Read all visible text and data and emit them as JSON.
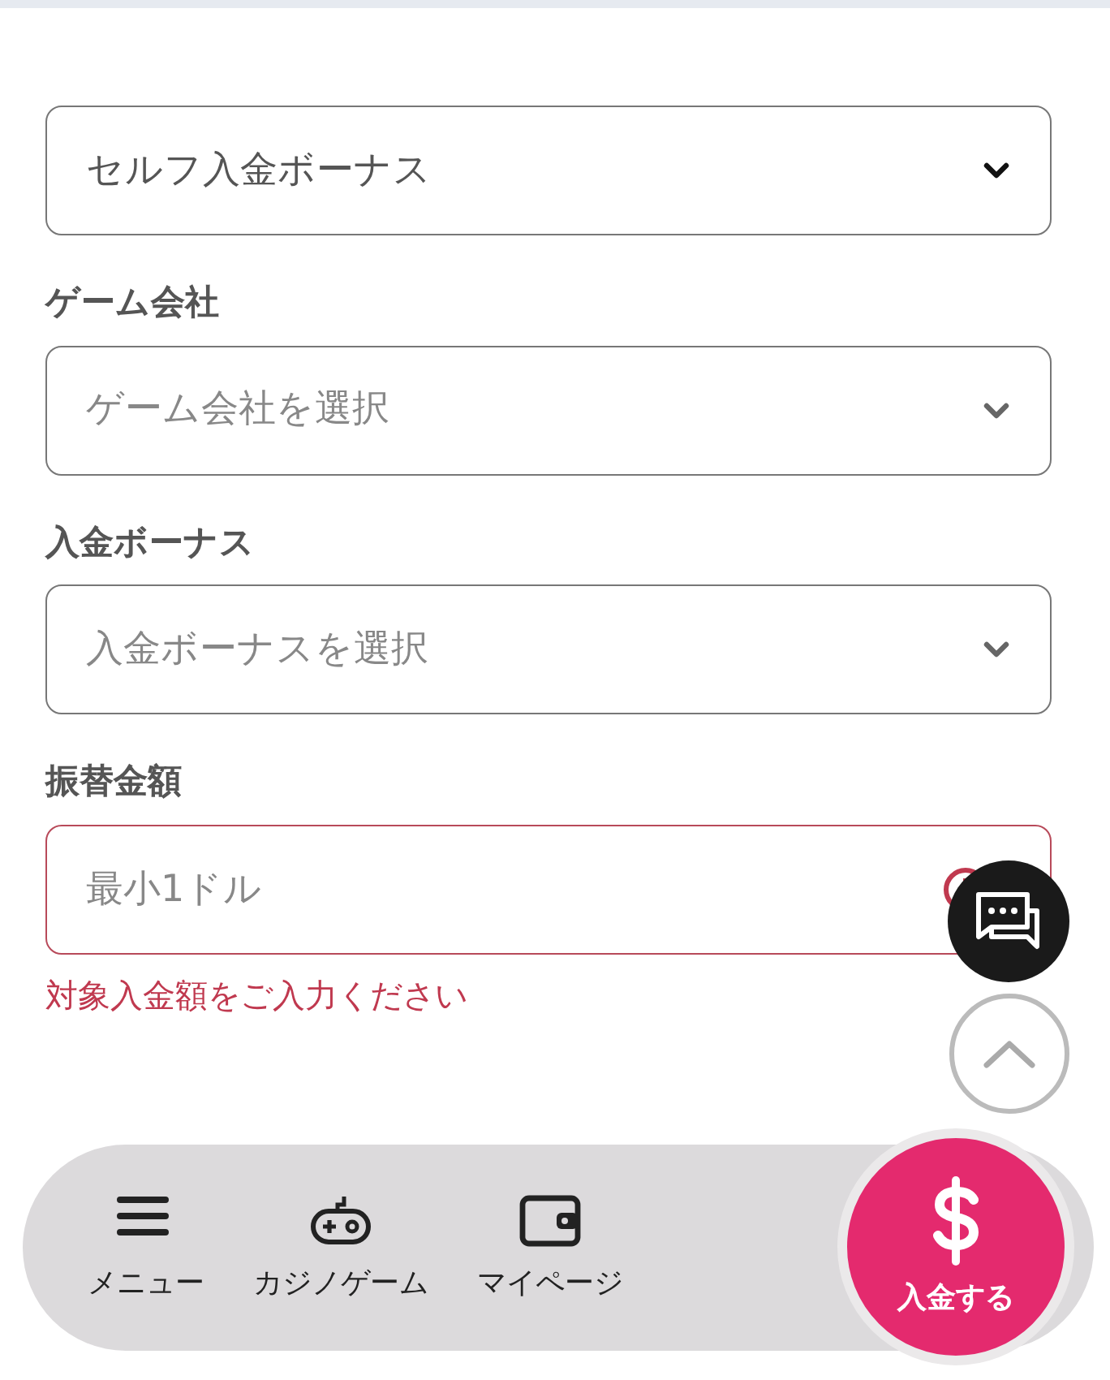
{
  "fields": [
    {
      "kind": "select",
      "value": "セルフ入金ボーナス",
      "invalid": false
    },
    {
      "kind": "select",
      "label": "ゲーム会社",
      "placeholder": "ゲーム会社を選択",
      "invalid": false
    },
    {
      "kind": "select",
      "label": "入金ボーナス",
      "placeholder": "入金ボーナスを選択",
      "invalid": false
    },
    {
      "kind": "input",
      "label": "振替金額",
      "placeholder": "最小1ドル",
      "invalid": true,
      "error": "対象入金額をご入力ください"
    }
  ],
  "bottom_nav": {
    "items": [
      {
        "kind": "menu",
        "label": "メニュー"
      },
      {
        "kind": "gamepad",
        "label": "カジノゲーム"
      },
      {
        "kind": "wallet",
        "label": "マイページ"
      }
    ],
    "deposit": {
      "label": "入金する"
    }
  }
}
